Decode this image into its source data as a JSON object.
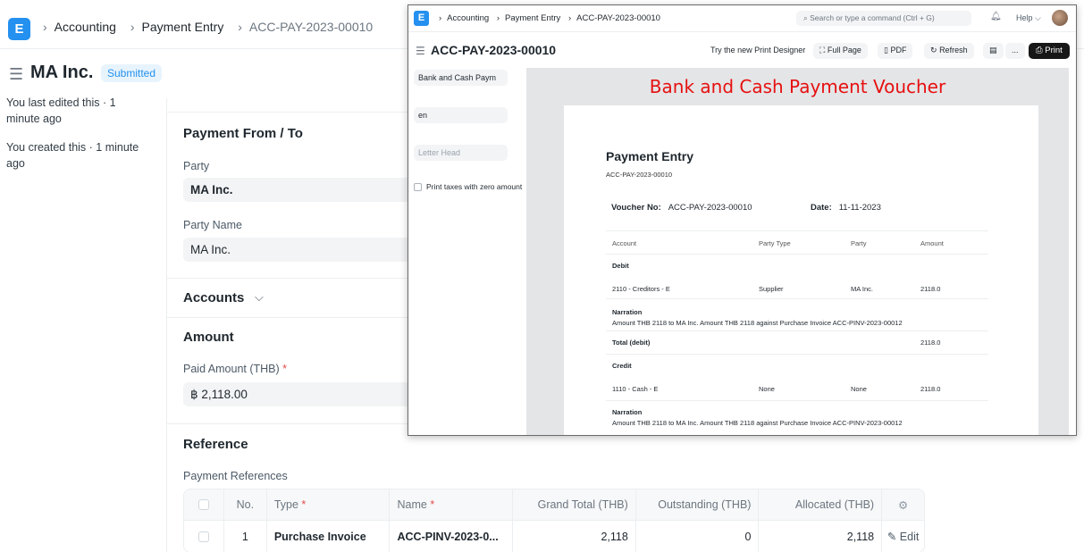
{
  "nav": {
    "logo": "E",
    "breadcrumbs": [
      "Accounting",
      "Payment Entry",
      "ACC-PAY-2023-00010"
    ]
  },
  "doc": {
    "title": "MA Inc.",
    "status": "Submitted"
  },
  "sidebar": {
    "edited": "You last edited this · 1 minute ago",
    "created": "You created this · 1 minute ago"
  },
  "form": {
    "payment_section": "Payment From / To",
    "party_label": "Party",
    "party_value": "MA Inc.",
    "party_name_label": "Party Name",
    "party_name_value": "MA Inc.",
    "accounts_section": "Accounts",
    "amount_section": "Amount",
    "paid_amount_label": "Paid Amount (THB)",
    "paid_amount_value": "฿ 2,118.00",
    "reference_section": "Reference",
    "payment_references_label": "Payment References"
  },
  "references": {
    "columns": [
      "No.",
      "Type",
      "Name",
      "Grand Total (THB)",
      "Outstanding (THB)",
      "Allocated (THB)"
    ],
    "rows": [
      {
        "no": "1",
        "type": "Purchase Invoice",
        "name": "ACC-PINV-2023-0...",
        "grand_total": "2,118",
        "outstanding": "0",
        "allocated": "2,118",
        "edit": "Edit"
      }
    ]
  },
  "print_window": {
    "logo": "E",
    "breadcrumbs": [
      "Accounting",
      "Payment Entry",
      "ACC-PAY-2023-00010"
    ],
    "search_placeholder": "Search or type a command (Ctrl + G)",
    "help": "Help",
    "title": "ACC-PAY-2023-00010",
    "try_designer": "Try the new Print Designer",
    "full_page": "Full Page",
    "pdf": "PDF",
    "refresh": "Refresh",
    "more": "...",
    "print": "Print",
    "print_format": "Bank and Cash Paym",
    "language": "en",
    "letter_head_placeholder": "Letter Head",
    "zero_taxes_label": "Print taxes with zero amount",
    "preview_title": "Bank and Cash Payment Voucher",
    "paper": {
      "heading": "Payment Entry",
      "doc_no": "ACC-PAY-2023-00010",
      "voucher_label": "Voucher No:",
      "voucher_value": "ACC-PAY-2023-00010",
      "date_label": "Date:",
      "date_value": "11-11-2023",
      "columns": [
        "Account",
        "Party Type",
        "Party",
        "Amount"
      ],
      "debit_label": "Debit",
      "debit_row": {
        "account": "2110 - Creditors - E",
        "party_type": "Supplier",
        "party": "MA Inc.",
        "amount": "2118.0"
      },
      "narration_label": "Narration",
      "narration_text": "Amount THB 2118 to MA Inc. Amount THB 2118 against Purchase Invoice ACC-PINV-2023-00012",
      "total_debit_label": "Total (debit)",
      "total_debit_value": "2118.0",
      "credit_label": "Credit",
      "credit_row": {
        "account": "1110 - Cash - E",
        "party_type": "None",
        "party": "None",
        "amount": "2118.0"
      },
      "narration2_label": "Narration",
      "narration2_text": "Amount THB 2118 to MA Inc. Amount THB 2118 against Purchase Invoice ACC-PINV-2023-00012"
    }
  },
  "colors": {
    "accent": "#2490ef",
    "voucher_title": "#e61010",
    "print_button": "#171717"
  }
}
